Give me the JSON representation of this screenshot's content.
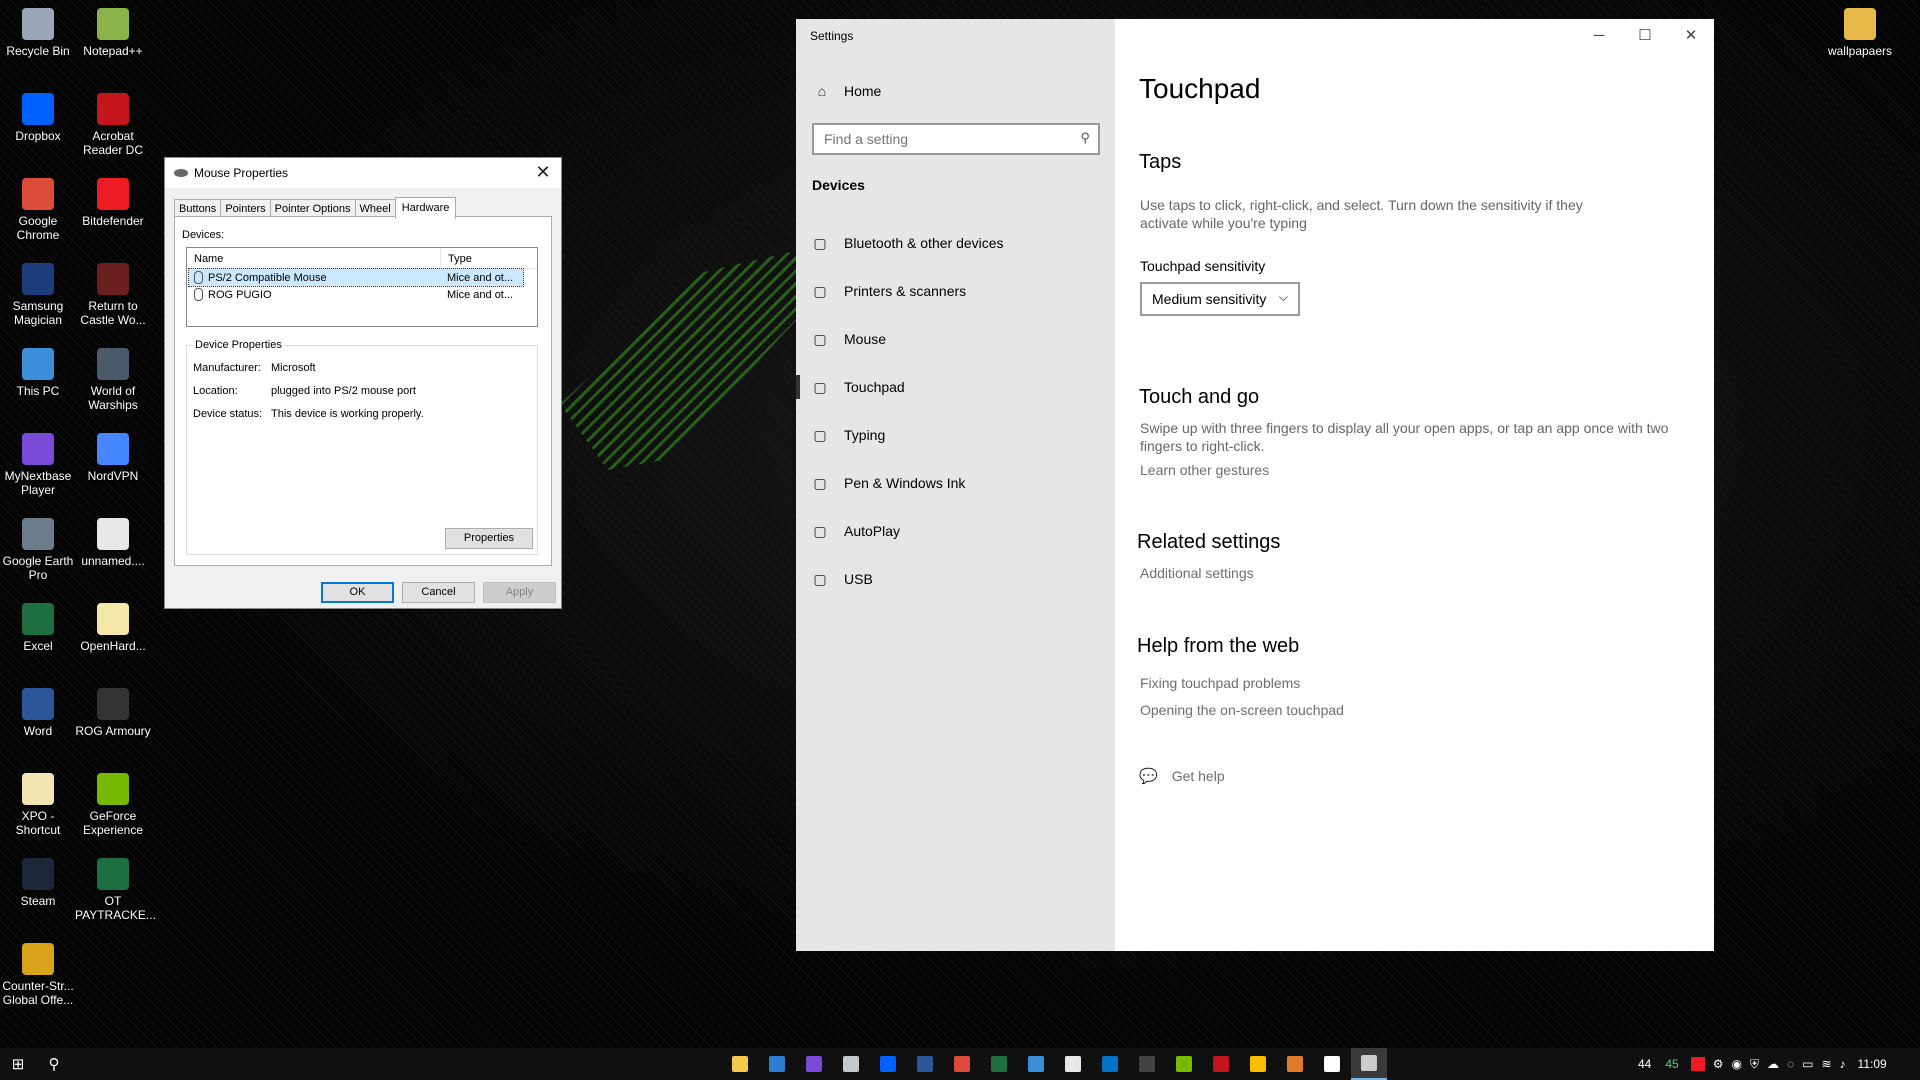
{
  "desktop": {
    "icons_left": [
      {
        "label": "Recycle Bin",
        "icon": "recycle-bin-icon",
        "color": "#9aa7b4"
      },
      {
        "label": "Dropbox",
        "icon": "dropbox-icon",
        "color": "#0061fe"
      },
      {
        "label": "Google Chrome",
        "icon": "chrome-icon",
        "color": "#dd4b39"
      },
      {
        "label": "Samsung Magician",
        "icon": "samsung-magician-icon",
        "color": "#1c3d7a"
      },
      {
        "label": "This PC",
        "icon": "this-pc-icon",
        "color": "#3a8fd8"
      },
      {
        "label": "MyNextbase Player",
        "icon": "nextbase-icon",
        "color": "#7b4ad8"
      },
      {
        "label": "Google Earth Pro",
        "icon": "google-earth-icon",
        "color": "#6b7c8a"
      },
      {
        "label": "Excel",
        "icon": "excel-icon",
        "color": "#1d6f42"
      },
      {
        "label": "Word",
        "icon": "word-icon",
        "color": "#2b579a"
      },
      {
        "label": "XPO - Shortcut",
        "icon": "xpo-shortcut-icon",
        "color": "#f2e6b0"
      },
      {
        "label": "Steam",
        "icon": "steam-icon",
        "color": "#1b2838"
      },
      {
        "label": "Counter-Str... Global Offe...",
        "icon": "csgo-icon",
        "color": "#d9a21b"
      }
    ],
    "icons_right_col": [
      {
        "label": "Notepad++",
        "icon": "notepad-plus-icon",
        "color": "#8ab34a"
      },
      {
        "label": "Acrobat Reader DC",
        "icon": "acrobat-icon",
        "color": "#c4161c"
      },
      {
        "label": "Bitdefender",
        "icon": "bitdefender-icon",
        "color": "#ed1c24"
      },
      {
        "label": "Return to Castle Wo...",
        "icon": "rtcw-icon",
        "color": "#6b2020"
      },
      {
        "label": "World of Warships",
        "icon": "world-of-warships-icon",
        "color": "#4a5a6a"
      },
      {
        "label": "NordVPN",
        "icon": "nordvpn-icon",
        "color": "#4687ff"
      },
      {
        "label": "unnamed....",
        "icon": "image-file-icon",
        "color": "#e8e8e8"
      },
      {
        "label": "OpenHard...",
        "icon": "openhardware-icon",
        "color": "#f5e7a8"
      },
      {
        "label": "ROG Armoury",
        "icon": "rog-armoury-icon",
        "color": "#333333"
      },
      {
        "label": "GeForce Experience",
        "icon": "geforce-icon",
        "color": "#76b900"
      },
      {
        "label": "OT PAYTRACKE...",
        "icon": "excel-file-icon",
        "color": "#1d6f42"
      }
    ],
    "icon_far_right": {
      "label": "wallpapaers",
      "icon": "folder-icon",
      "color": "#e6b94a"
    }
  },
  "mouse_props": {
    "title": "Mouse Properties",
    "tabs": [
      "Buttons",
      "Pointers",
      "Pointer Options",
      "Wheel",
      "Hardware"
    ],
    "active_tab": "Hardware",
    "devices_label": "Devices:",
    "columns": [
      "Name",
      "Type"
    ],
    "devices": [
      {
        "name": "PS/2 Compatible Mouse",
        "type": "Mice and ot..."
      },
      {
        "name": "ROG PUGIO",
        "type": "Mice and ot..."
      }
    ],
    "group_title": "Device Properties",
    "properties": [
      {
        "k": "Manufacturer:",
        "v": "Microsoft"
      },
      {
        "k": "Location:",
        "v": "plugged into PS/2 mouse port"
      },
      {
        "k": "Device status:",
        "v": "This device is working properly."
      }
    ],
    "properties_button": "Properties",
    "ok": "OK",
    "cancel": "Cancel",
    "apply": "Apply"
  },
  "settings": {
    "window_title": "Settings",
    "home": "Home",
    "search_placeholder": "Find a setting",
    "section": "Devices",
    "nav": [
      {
        "label": "Bluetooth & other devices",
        "icon": "bluetooth-devices-icon"
      },
      {
        "label": "Printers & scanners",
        "icon": "printer-icon"
      },
      {
        "label": "Mouse",
        "icon": "mouse-icon"
      },
      {
        "label": "Touchpad",
        "icon": "touchpad-icon"
      },
      {
        "label": "Typing",
        "icon": "keyboard-icon"
      },
      {
        "label": "Pen & Windows Ink",
        "icon": "pen-icon"
      },
      {
        "label": "AutoPlay",
        "icon": "autoplay-icon"
      },
      {
        "label": "USB",
        "icon": "usb-icon"
      }
    ],
    "active_nav": "Touchpad",
    "page_title": "Touchpad",
    "taps": {
      "heading": "Taps",
      "desc": "Use taps to click, right-click, and select. Turn down the sensitivity if they activate while you're typing",
      "sensitivity_label": "Touchpad sensitivity",
      "sensitivity_value": "Medium sensitivity"
    },
    "touch_and_go": {
      "heading": "Touch and go",
      "desc": "Swipe up with three fingers to display all your open apps, or tap an app once with two fingers to right-click.",
      "link": "Learn other gestures"
    },
    "related": {
      "heading": "Related settings",
      "link": "Additional settings"
    },
    "help": {
      "heading": "Help from the web",
      "links": [
        "Fixing touchpad problems",
        "Opening the on-screen touchpad"
      ]
    },
    "get_help": "Get help"
  },
  "taskbar": {
    "apps": [
      {
        "icon": "file-explorer-icon",
        "color": "#f2c94c"
      },
      {
        "icon": "remote-desktop-icon",
        "color": "#2d7dd2"
      },
      {
        "icon": "nextbase-icon",
        "color": "#7b4ad8"
      },
      {
        "icon": "google-earth-icon",
        "color": "#c0c8d0"
      },
      {
        "icon": "dropbox-icon",
        "color": "#0061fe"
      },
      {
        "icon": "word-icon",
        "color": "#2b579a"
      },
      {
        "icon": "chrome-icon",
        "color": "#dd4b39"
      },
      {
        "icon": "excel-icon",
        "color": "#1d6f42"
      },
      {
        "icon": "this-pc-icon",
        "color": "#3a8fd8"
      },
      {
        "icon": "notepad-icon",
        "color": "#e8e8e8"
      },
      {
        "icon": "outlook-icon",
        "color": "#0072c6"
      },
      {
        "icon": "terminal-icon",
        "color": "#444444"
      },
      {
        "icon": "geforce-icon",
        "color": "#76b900"
      },
      {
        "icon": "rog-icon",
        "color": "#c4161c"
      },
      {
        "icon": "gdrive-icon",
        "color": "#fbbc04"
      },
      {
        "icon": "hwinfo-icon",
        "color": "#e07b2a"
      },
      {
        "icon": "settings-gear-icon",
        "color": "#ffffff"
      },
      {
        "icon": "mouse-properties-icon",
        "color": "#cccccc"
      }
    ],
    "tray": {
      "cpu_temp": "44",
      "gpu_temp": "45",
      "gpu_color": "#4cd964",
      "time": "11:09"
    }
  }
}
